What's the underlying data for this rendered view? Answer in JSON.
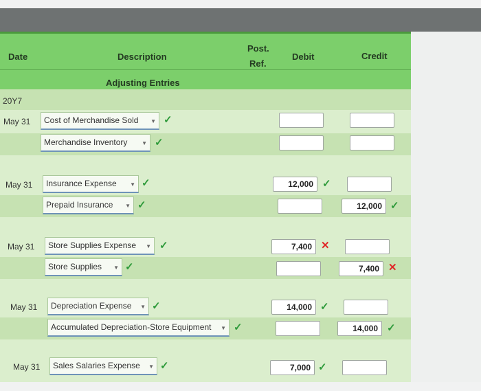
{
  "headers": {
    "date": "Date",
    "description": "Description",
    "post_ref_line1": "Post.",
    "post_ref_line2": "Ref.",
    "debit": "Debit",
    "credit": "Credit",
    "section_title": "Adjusting Entries"
  },
  "year": "20Y7",
  "entries": [
    {
      "date": "May 31",
      "debit_account": "Cost of Merchandise Sold",
      "credit_account": "Merchandise Inventory",
      "debit_value": "",
      "credit_value": ""
    },
    {
      "date": "May 31",
      "debit_account": "Insurance Expense",
      "credit_account": "Prepaid Insurance",
      "debit_value": "12,000",
      "credit_value": "12,000"
    },
    {
      "date": "May 31",
      "debit_account": "Store Supplies Expense",
      "credit_account": "Store Supplies",
      "debit_value": "7,400",
      "credit_value": "7,400"
    },
    {
      "date": "May 31",
      "debit_account": "Depreciation Expense",
      "credit_account": "Accumulated Depreciation-Store Equipment",
      "debit_value": "14,000",
      "credit_value": "14,000"
    },
    {
      "date": "May 31",
      "debit_account": "Sales Salaries Expense",
      "credit_account": "",
      "debit_value": "7,000",
      "credit_value": ""
    }
  ],
  "marks": {
    "correct": "✓",
    "incorrect": "✕"
  },
  "colors": {
    "header": "#7ccf6b",
    "correct": "#2e9a3a",
    "incorrect": "#e02a2a"
  }
}
